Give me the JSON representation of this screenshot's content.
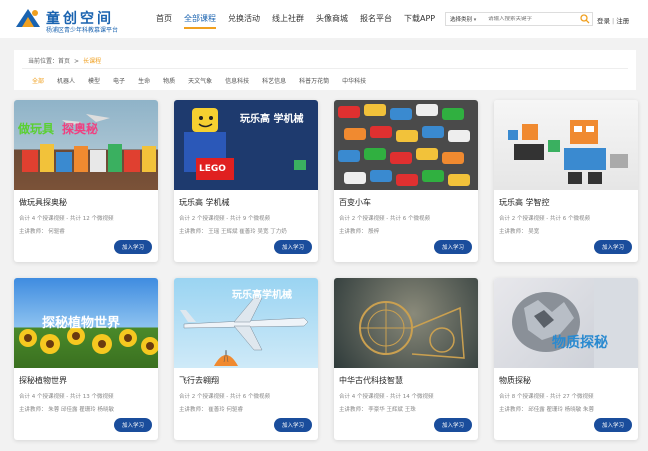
{
  "brand": {
    "title": "童创空间",
    "subtitle": "杨浦区青少年科教慕课平台",
    "colors": {
      "primary": "#1a63b0",
      "accent": "#f0a020",
      "button": "#1a4d9c"
    }
  },
  "nav": {
    "items": [
      {
        "label": "首页"
      },
      {
        "label": "全部课程"
      },
      {
        "label": "兑换活动"
      },
      {
        "label": "线上社群"
      },
      {
        "label": "头像商城"
      },
      {
        "label": "报名平台"
      },
      {
        "label": "下载APP"
      }
    ],
    "active_index": 1
  },
  "search": {
    "scope": "选择类别",
    "placeholder": "请输入搜索关键字",
    "icon": "search-icon"
  },
  "auth": {
    "login": "登录",
    "separator": "|",
    "register": "注册"
  },
  "breadcrumb": {
    "prefix": "当前位置：",
    "home": "首页",
    "arrow": ">",
    "current": "长课程"
  },
  "categories": [
    {
      "label": "全部"
    },
    {
      "label": "机器人"
    },
    {
      "label": "模型"
    },
    {
      "label": "电子"
    },
    {
      "label": "生命"
    },
    {
      "label": "物质"
    },
    {
      "label": "天文气象"
    },
    {
      "label": "信息科技"
    },
    {
      "label": "科艺信息"
    },
    {
      "label": "科普万花筒"
    },
    {
      "label": "中华科技"
    }
  ],
  "courses": [
    {
      "title": "做玩具探奥秘",
      "meta": "合计 4 个授课视频 - 共计 12 个微视频",
      "teachers": "主讲教师：  何驱睿",
      "button": "加入学习",
      "thumb_text": [
        "做玩具",
        "探奥秘"
      ]
    },
    {
      "title": "玩乐高 学机械",
      "meta": "合计 2 个授课视频 - 共计 9 个微视频",
      "teachers": "主讲教师：  王瑶  王辉斌  崔善玲  吴宽  丁力奶",
      "button": "加入学习",
      "thumb_text": [
        "玩乐高 学机械",
        "LEGO"
      ]
    },
    {
      "title": "百变小车",
      "meta": "合计 2 个授课视频 - 共计 6 个微视频",
      "teachers": "主讲教师：  殷梓",
      "button": "加入学习",
      "thumb_text": []
    },
    {
      "title": "玩乐高 学智控",
      "meta": "合计 2 个授课视频 - 共计 6 个微视频",
      "teachers": "主讲教师：  吴宽",
      "button": "加入学习",
      "thumb_text": []
    },
    {
      "title": "探秘植物世界",
      "meta": "合计 4 个授课视频 - 共计 13 个微视频",
      "teachers": "主讲教师：  朱蓉  邱佳露  瞿珊玲  杨晓敏",
      "button": "加入学习",
      "thumb_text": [
        "探秘植物世界"
      ]
    },
    {
      "title": "飞行去翱翔",
      "meta": "合计 2 个授课视频 - 共计 6 个微视频",
      "teachers": "主讲教师：  崔善玲  何驱睿",
      "button": "加入学习",
      "thumb_text": [
        "玩乐高学机械"
      ]
    },
    {
      "title": "中华古代科技智慧",
      "meta": "合计 4 个授课视频 - 共计 14 个微视频",
      "teachers": "主讲教师：  李豪华  王辉斌  王珠",
      "button": "加入学习",
      "thumb_text": []
    },
    {
      "title": "物质探秘",
      "meta": "合计 8 个授课视频 - 共计 27 个微视频",
      "teachers": "主讲教师：  邱佳露  瞿珊玲  杨晓敏  朱蓉",
      "button": "加入学习",
      "thumb_text": [
        "物质探秘"
      ]
    }
  ]
}
